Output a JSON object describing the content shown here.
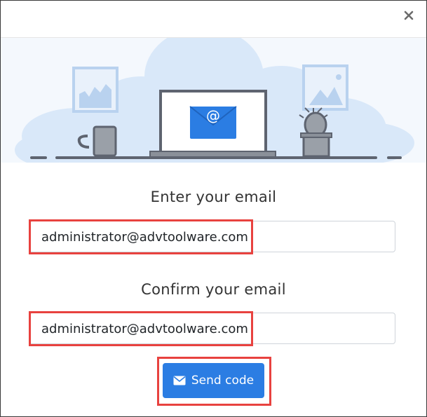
{
  "dialog": {
    "close_label": "×"
  },
  "form": {
    "email_label": "Enter your email",
    "email_value": "administrator@advtoolware.com",
    "confirm_label": "Confirm your email",
    "confirm_value": "administrator@advtoolware.com",
    "submit_label": "Send code"
  },
  "colors": {
    "accent": "#2b7de3",
    "highlight": "#e8423f",
    "illustration_bg": "#f4f8fd"
  }
}
